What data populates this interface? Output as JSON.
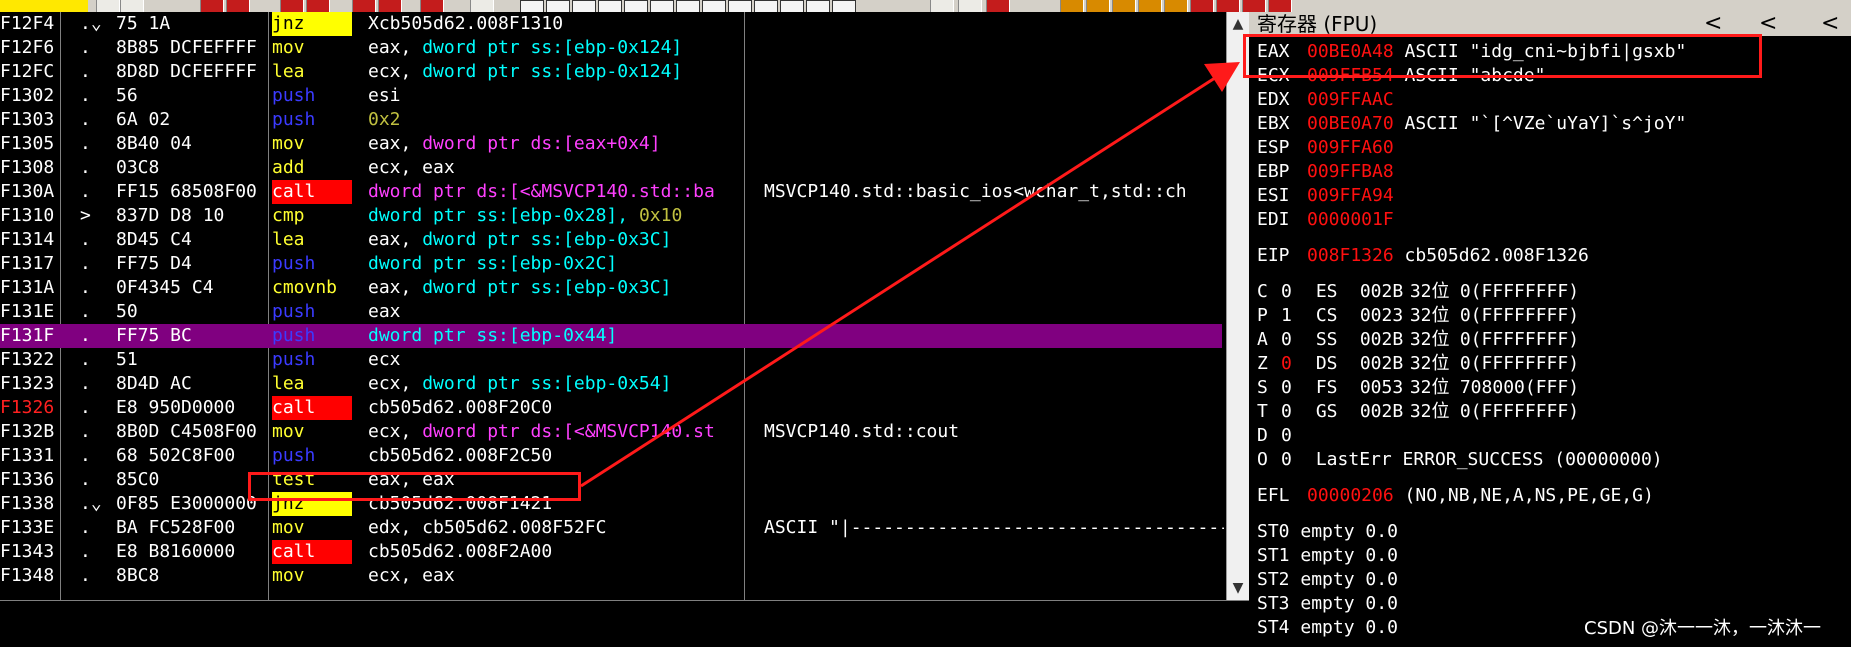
{
  "disasm": {
    "rows": [
      {
        "addr": "F12F4",
        "mark": ".⌄",
        "hex": "75 1A",
        "mnemonic": "jnz",
        "mcls": "m-jnz",
        "ops": [
          {
            "t": "Xcb505d62.008F1310",
            "c": "o-w"
          }
        ],
        "comment": ""
      },
      {
        "addr": "F12F6",
        "mark": ".",
        "hex": "8B85 DCFEFFFF",
        "mnemonic": "mov",
        "mcls": "m-mov",
        "ops": [
          {
            "t": "eax, ",
            "c": "o-w"
          },
          {
            "t": "dword ptr ss:[ebp-0x124]",
            "c": "o-c"
          }
        ],
        "comment": ""
      },
      {
        "addr": "F12FC",
        "mark": ".",
        "hex": "8D8D DCFEFFFF",
        "mnemonic": "lea",
        "mcls": "m-lea",
        "ops": [
          {
            "t": "ecx, ",
            "c": "o-w"
          },
          {
            "t": "dword ptr ss:[ebp-0x124]",
            "c": "o-c"
          }
        ],
        "comment": ""
      },
      {
        "addr": "F1302",
        "mark": ".",
        "hex": "56",
        "mnemonic": "push",
        "mcls": "m-push",
        "ops": [
          {
            "t": "esi",
            "c": "o-w"
          }
        ],
        "comment": ""
      },
      {
        "addr": "F1303",
        "mark": ".",
        "hex": "6A 02",
        "mnemonic": "push",
        "mcls": "m-push",
        "ops": [
          {
            "t": "0x2",
            "c": "o-y"
          }
        ],
        "comment": ""
      },
      {
        "addr": "F1305",
        "mark": ".",
        "hex": "8B40 04",
        "mnemonic": "mov",
        "mcls": "m-mov",
        "ops": [
          {
            "t": "eax, ",
            "c": "o-w"
          },
          {
            "t": "dword ptr ds:[eax+0x4]",
            "c": "o-m"
          }
        ],
        "comment": ""
      },
      {
        "addr": "F1308",
        "mark": ".",
        "hex": "03C8",
        "mnemonic": "add",
        "mcls": "m-add",
        "ops": [
          {
            "t": "ecx, eax",
            "c": "o-w"
          }
        ],
        "comment": ""
      },
      {
        "addr": "F130A",
        "mark": ".",
        "hex": "FF15 68508F00",
        "mnemonic": "call",
        "mcls": "m-call",
        "ops": [
          {
            "t": "dword ptr ds:[<&MSVCP140.std::ba",
            "c": "o-m"
          }
        ],
        "comment": "MSVCP140.std::basic_ios<wchar_t,std::ch"
      },
      {
        "addr": "F1310",
        "mark": ">",
        "hex": "837D D8 10",
        "mnemonic": "cmp",
        "mcls": "m-cmp",
        "ops": [
          {
            "t": "dword ptr ss:[ebp-0x28], ",
            "c": "o-c"
          },
          {
            "t": "0x10",
            "c": "o-y"
          }
        ],
        "comment": ""
      },
      {
        "addr": "F1314",
        "mark": ".",
        "hex": "8D45 C4",
        "mnemonic": "lea",
        "mcls": "m-lea",
        "ops": [
          {
            "t": "eax, ",
            "c": "o-w"
          },
          {
            "t": "dword ptr ss:[ebp-0x3C]",
            "c": "o-c"
          }
        ],
        "comment": ""
      },
      {
        "addr": "F1317",
        "mark": ".",
        "hex": "FF75 D4",
        "mnemonic": "push",
        "mcls": "m-push",
        "ops": [
          {
            "t": "dword ptr ss:[ebp-0x2C]",
            "c": "o-c"
          }
        ],
        "comment": ""
      },
      {
        "addr": "F131A",
        "mark": ".",
        "hex": "0F4345 C4",
        "mnemonic": "cmovnb",
        "mcls": "m-cmovnb",
        "ops": [
          {
            "t": "eax, ",
            "c": "o-w"
          },
          {
            "t": "dword ptr ss:[ebp-0x3C]",
            "c": "o-c"
          }
        ],
        "comment": ""
      },
      {
        "addr": "F131E",
        "mark": ".",
        "hex": "50",
        "mnemonic": "push",
        "mcls": "m-push",
        "ops": [
          {
            "t": "eax",
            "c": "o-w"
          }
        ],
        "comment": ""
      },
      {
        "addr": "F131F",
        "mark": ".",
        "hex": "FF75 BC",
        "mnemonic": "push",
        "mcls": "m-push",
        "ops": [
          {
            "t": "dword ptr ss:[ebp-0x44]",
            "c": "o-c"
          }
        ],
        "comment": "",
        "selected": true
      },
      {
        "addr": "F1322",
        "mark": ".",
        "hex": "51",
        "mnemonic": "push",
        "mcls": "m-push",
        "ops": [
          {
            "t": "ecx",
            "c": "o-w"
          }
        ],
        "comment": ""
      },
      {
        "addr": "F1323",
        "mark": ".",
        "hex": "8D4D AC",
        "mnemonic": "lea",
        "mcls": "m-lea",
        "ops": [
          {
            "t": "ecx, ",
            "c": "o-w"
          },
          {
            "t": "dword ptr ss:[ebp-0x54]",
            "c": "o-c"
          }
        ],
        "comment": ""
      },
      {
        "addr": "F1326",
        "mark": ".",
        "hex": "E8 950D0000",
        "mnemonic": "call",
        "mcls": "m-call",
        "ops": [
          {
            "t": "cb505d62.008F20C0",
            "c": "o-w"
          }
        ],
        "comment": "",
        "addrRed": true
      },
      {
        "addr": "F132B",
        "mark": ".",
        "hex": "8B0D C4508F00",
        "mnemonic": "mov",
        "mcls": "m-mov",
        "ops": [
          {
            "t": "ecx, ",
            "c": "o-w"
          },
          {
            "t": "dword ptr ds:[<&MSVCP140.st",
            "c": "o-m"
          }
        ],
        "comment": "MSVCP140.std::cout"
      },
      {
        "addr": "F1331",
        "mark": ".",
        "hex": "68 502C8F00",
        "mnemonic": "push",
        "mcls": "m-push",
        "ops": [
          {
            "t": "cb505d62.008F2C50",
            "c": "o-w"
          }
        ],
        "comment": ""
      },
      {
        "addr": "F1336",
        "mark": ".",
        "hex": "85C0",
        "mnemonic": "test",
        "mcls": "m-test",
        "ops": [
          {
            "t": "eax, eax",
            "c": "o-w"
          }
        ],
        "comment": ""
      },
      {
        "addr": "F1338",
        "mark": ".⌄",
        "hex": "0F85 E3000000",
        "mnemonic": "jnz",
        "mcls": "m-jnz",
        "ops": [
          {
            "t": "cb505d62.008F1421",
            "c": "o-w"
          }
        ],
        "comment": ""
      },
      {
        "addr": "F133E",
        "mark": ".",
        "hex": "BA FC528F00",
        "mnemonic": "mov",
        "mcls": "m-mov",
        "ops": [
          {
            "t": "edx, cb505d62.008F52FC",
            "c": "o-w"
          }
        ],
        "comment": "ASCII \"|------------------------------------"
      },
      {
        "addr": "F1343",
        "mark": ".",
        "hex": "E8 B8160000",
        "mnemonic": "call",
        "mcls": "m-call",
        "ops": [
          {
            "t": "cb505d62.008F2A00",
            "c": "o-w"
          }
        ],
        "comment": ""
      },
      {
        "addr": "F1348",
        "mark": ".",
        "hex": "8BC8",
        "mnemonic": "mov",
        "mcls": "m-mov",
        "ops": [
          {
            "t": "ecx, eax",
            "c": "o-w"
          }
        ],
        "comment": ""
      }
    ]
  },
  "registers": {
    "title": "寄存器 (FPU)",
    "nav_left": "<",
    "nav_left2": "<",
    "nav_left3": "<",
    "gp": [
      {
        "name": "EAX",
        "value": "00BE0A48",
        "note": "ASCII \"idg_cni~bjbfi|gsxb\""
      },
      {
        "name": "ECX",
        "value": "009FFB54",
        "note": "ASCII \"abcde\""
      },
      {
        "name": "EDX",
        "value": "009FFAAC",
        "note": ""
      },
      {
        "name": "EBX",
        "value": "00BE0A70",
        "note": "ASCII \"`[^VZe`uYaY]`s^joY\""
      },
      {
        "name": "ESP",
        "value": "009FFA60",
        "note": ""
      },
      {
        "name": "EBP",
        "value": "009FFBA8",
        "note": ""
      },
      {
        "name": "ESI",
        "value": "009FFA94",
        "note": ""
      },
      {
        "name": "EDI",
        "value": "0000001F",
        "note": ""
      }
    ],
    "eip": {
      "name": "EIP",
      "value": "008F1326",
      "note": "cb505d62.008F1326"
    },
    "flags": [
      {
        "f": "C",
        "v": "0",
        "seg": "ES",
        "sv": "002B",
        "bits": "32位",
        "lim": "0(FFFFFFFF)"
      },
      {
        "f": "P",
        "v": "1",
        "seg": "CS",
        "sv": "0023",
        "bits": "32位",
        "lim": "0(FFFFFFFF)"
      },
      {
        "f": "A",
        "v": "0",
        "seg": "SS",
        "sv": "002B",
        "bits": "32位",
        "lim": "0(FFFFFFFF)"
      },
      {
        "f": "Z",
        "v": "0",
        "seg": "DS",
        "sv": "002B",
        "bits": "32位",
        "lim": "0(FFFFFFFF)",
        "vRed": true
      },
      {
        "f": "S",
        "v": "0",
        "seg": "FS",
        "sv": "0053",
        "bits": "32位",
        "lim": "708000(FFF)"
      },
      {
        "f": "T",
        "v": "0",
        "seg": "GS",
        "sv": "002B",
        "bits": "32位",
        "lim": "0(FFFFFFFF)"
      },
      {
        "f": "D",
        "v": "0"
      },
      {
        "f": "O",
        "v": "0",
        "lasterr": "LastErr ERROR_SUCCESS (00000000)"
      }
    ],
    "efl": {
      "name": "EFL",
      "value": "00000206",
      "note": "(NO,NB,NE,A,NS,PE,GE,G)"
    },
    "fpu": [
      {
        "name": "ST0",
        "state": "empty",
        "val": "0.0"
      },
      {
        "name": "ST1",
        "state": "empty",
        "val": "0.0"
      },
      {
        "name": "ST2",
        "state": "empty",
        "val": "0.0"
      },
      {
        "name": "ST3",
        "state": "empty",
        "val": "0.0"
      },
      {
        "name": "ST4",
        "state": "empty",
        "val": "0.0"
      }
    ]
  },
  "watermark": "CSDN @沐一一沐，一沐沐一",
  "colors": {
    "annotation": "#ff1a1a",
    "selected_row": "#800080",
    "register_value": "#ff1010"
  }
}
